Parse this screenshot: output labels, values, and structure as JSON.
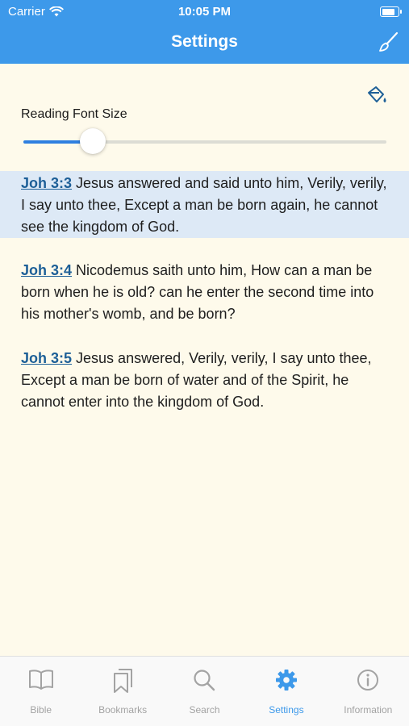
{
  "status_bar": {
    "carrier": "Carrier",
    "time": "10:05 PM",
    "battery_level": 0.85
  },
  "nav": {
    "title": "Settings"
  },
  "settings": {
    "font_size_label": "Reading Font Size",
    "font_size_value": 0.19
  },
  "verses": [
    {
      "ref": "Joh 3:3",
      "text": " Jesus answered and said unto him, Verily, verily, I say unto thee, Except a man be born again, he cannot see the kingdom of God.",
      "selected": true
    },
    {
      "ref": "Joh 3:4",
      "text": " Nicodemus saith unto him, How can a man be born when he is old? can he enter the second time into his mother's womb, and be born?",
      "selected": false
    },
    {
      "ref": "Joh 3:5",
      "text": " Jesus answered, Verily, verily, I say unto thee, Except a man be born of water and of the Spirit, he cannot enter into the kingdom of God.",
      "selected": false
    }
  ],
  "tabs": [
    {
      "label": "Bible",
      "icon": "book-icon",
      "active": false
    },
    {
      "label": "Bookmarks",
      "icon": "bookmarks-icon",
      "active": false
    },
    {
      "label": "Search",
      "icon": "search-icon",
      "active": false
    },
    {
      "label": "Settings",
      "icon": "gear-icon",
      "active": true
    },
    {
      "label": "Information",
      "icon": "info-icon",
      "active": false
    }
  ],
  "colors": {
    "accent": "#3d99ea",
    "background": "#fefaeb",
    "selected_verse": "#dde9f6",
    "verse_ref": "#1d5f97"
  }
}
